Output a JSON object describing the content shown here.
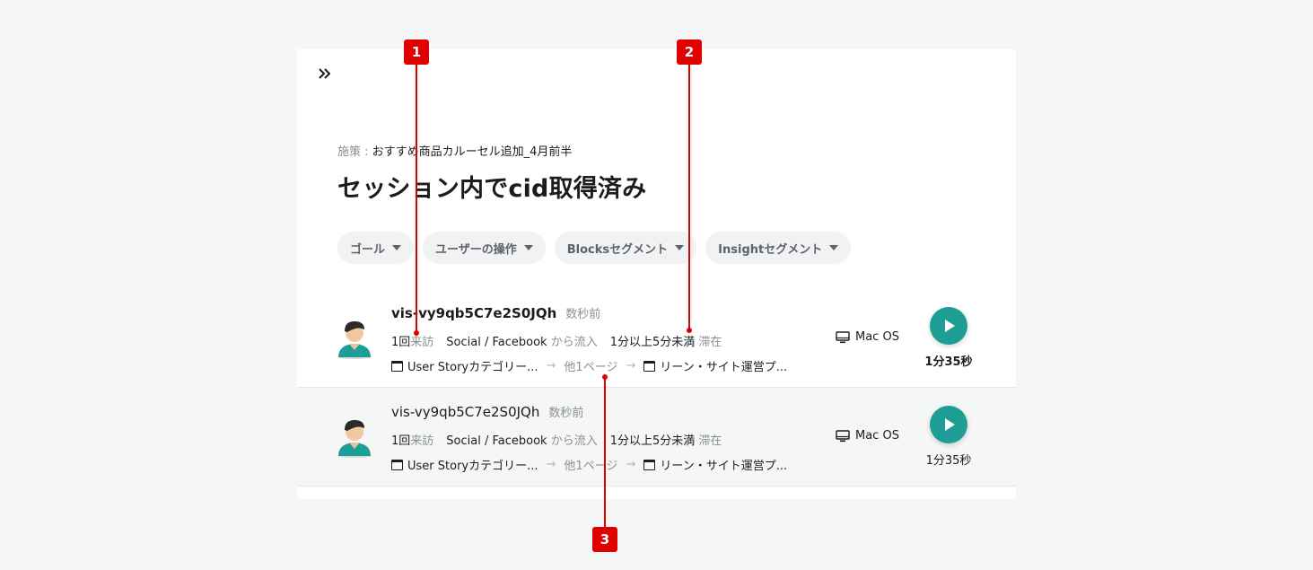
{
  "campaign": {
    "label": "施策 : ",
    "value": "おすすめ商品カルーセル追加_4月前半"
  },
  "title": "セッション内でcid取得済み",
  "filters": [
    {
      "label": "ゴール"
    },
    {
      "label": "ユーザーの操作"
    },
    {
      "label": "Blocksセグメント"
    },
    {
      "label": "Insightセグメント"
    }
  ],
  "sessions": [
    {
      "visitor_id": "vis-vy9qb5C7e2S0JQh",
      "time_ago": "数秒前",
      "visit_count": "1回",
      "visit_suffix": "来訪",
      "source": "Social",
      "source_sep": " / ",
      "medium": "Facebook",
      "source_suffix": " から流入",
      "stay": "1分以上5分未満",
      "stay_suffix": " 滞在",
      "page_first": "User Storyカテゴリー...",
      "page_other": "他1ページ",
      "page_last": "リーン・サイト運営プ...",
      "os": "Mac OS",
      "duration": "1分35秒"
    },
    {
      "visitor_id": "vis-vy9qb5C7e2S0JQh",
      "time_ago": "数秒前",
      "visit_count": "1回",
      "visit_suffix": "来訪",
      "source": "Social",
      "source_sep": " / ",
      "medium": "Facebook",
      "source_suffix": " から流入",
      "stay": "1分以上5分未満",
      "stay_suffix": " 滞在",
      "page_first": "User Storyカテゴリー...",
      "page_other": "他1ページ",
      "page_last": "リーン・サイト運営プ...",
      "os": "Mac OS",
      "duration": "1分35秒"
    }
  ],
  "annotations": [
    "1",
    "2",
    "3"
  ],
  "colors": {
    "accent": "#1c9e94",
    "callout": "#e00000"
  }
}
